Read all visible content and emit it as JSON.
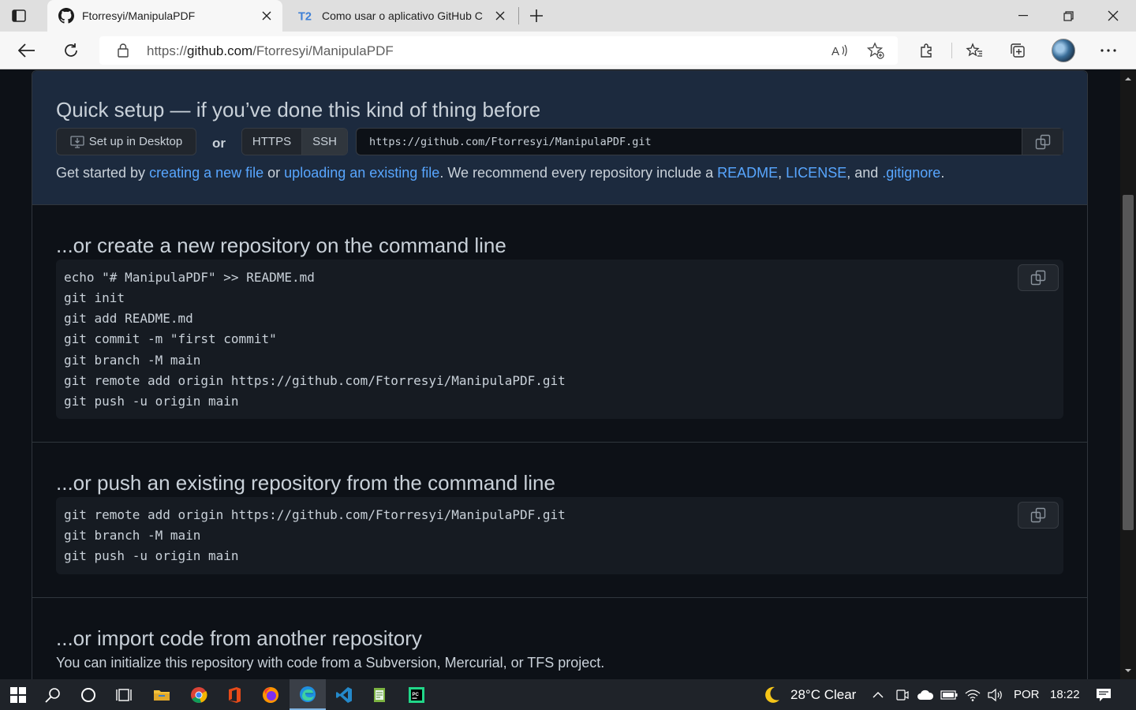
{
  "browser": {
    "tabs": [
      {
        "title": "Ftorresyi/ManipulaPDF",
        "active": true
      },
      {
        "title": "Como usar o aplicativo GitHub C",
        "active": false
      }
    ],
    "address": {
      "scheme": "https://",
      "host": "github.com",
      "path": "/Ftorresyi/ManipulaPDF"
    }
  },
  "quick_setup": {
    "title": "Quick setup — if you’ve done this kind of thing before",
    "desktop_button": "Set up in Desktop",
    "or": "or",
    "https": "HTTPS",
    "ssh": "SSH",
    "clone_url": "https://github.com/Ftorresyi/ManipulaPDF.git",
    "hint": {
      "t1": "Get started by ",
      "l1": "creating a new file",
      "t2": " or ",
      "l2": "uploading an existing file",
      "t3": ". We recommend every repository include a ",
      "l3": "README",
      "t4": ", ",
      "l4": "LICENSE",
      "t5": ", and ",
      "l5": ".gitignore",
      "t6": "."
    }
  },
  "create_section": {
    "title": "...or create a new repository on the command line",
    "lines": [
      "echo \"# ManipulaPDF\" >> README.md",
      "git init",
      "git add README.md",
      "git commit -m \"first commit\"",
      "git branch -M main",
      "git remote add origin https://github.com/Ftorresyi/ManipulaPDF.git",
      "git push -u origin main"
    ]
  },
  "push_section": {
    "title": "...or push an existing repository from the command line",
    "lines": [
      "git remote add origin https://github.com/Ftorresyi/ManipulaPDF.git",
      "git branch -M main",
      "git push -u origin main"
    ]
  },
  "import_section": {
    "title": "...or import code from another repository",
    "text": "You can initialize this repository with code from a Subversion, Mercurial, or TFS project."
  },
  "taskbar": {
    "weather": "28°C  Clear",
    "language": "POR",
    "time": "18:22"
  },
  "colors": {
    "accent_link": "#58a6ff",
    "quick_setup_bg": "#1c2a3e",
    "page_bg": "#0d1117"
  }
}
